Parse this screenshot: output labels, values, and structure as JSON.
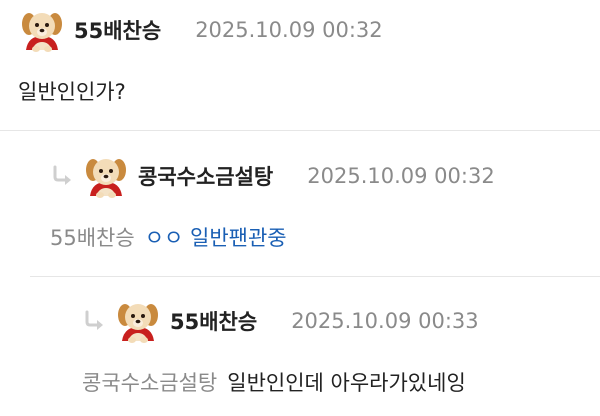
{
  "colors": {
    "nick": "#222222",
    "time": "#8a8a8a",
    "mention": "#8a8a8a",
    "link_text": "#1a5fb4",
    "divider": "#e6e6e6"
  },
  "comments": [
    {
      "avatar_icon": "puppy-avatar-icon",
      "nickname": "55배찬승",
      "timestamp": "2025.10.09 00:32",
      "text": "일반인인가?"
    },
    {
      "reply_icon": "reply-arrow-icon",
      "avatar_icon": "puppy-avatar-icon",
      "nickname": "콩국수소금설탕",
      "timestamp": "2025.10.09 00:32",
      "mention": "55배찬승",
      "text": "ㅇㅇ 일반팬관중"
    },
    {
      "reply_icon": "reply-arrow-icon",
      "avatar_icon": "puppy-avatar-icon",
      "nickname": "55배찬승",
      "timestamp": "2025.10.09 00:33",
      "mention": "콩국수소금설탕",
      "text": "일반인인데 아우라가있네잉"
    }
  ]
}
